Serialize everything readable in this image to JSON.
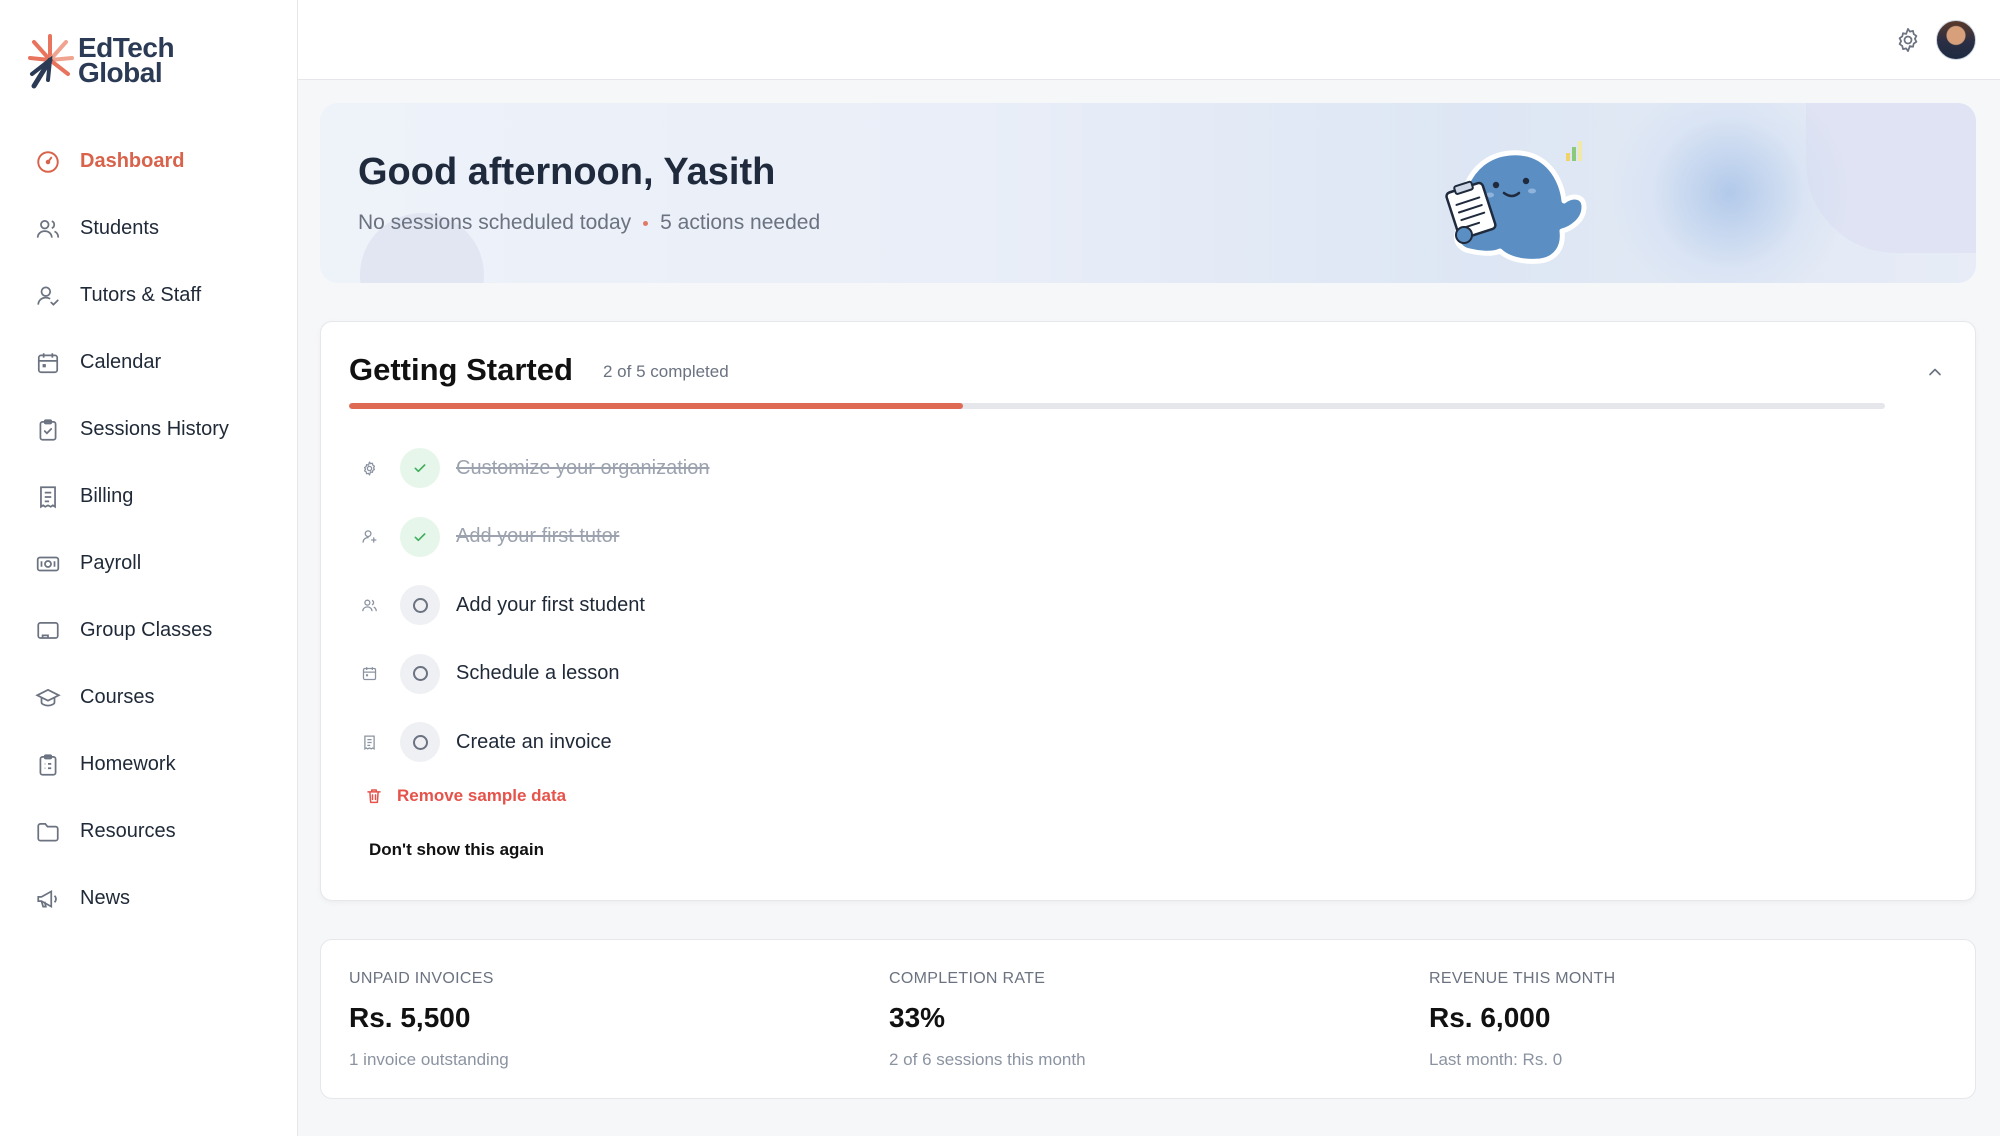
{
  "brand": {
    "name_line1": "EdTech",
    "name_line2": "Global"
  },
  "nav": [
    {
      "label": "Dashboard",
      "icon": "gauge-icon",
      "active": true
    },
    {
      "label": "Students",
      "icon": "users-icon"
    },
    {
      "label": "Tutors & Staff",
      "icon": "user-check-icon"
    },
    {
      "label": "Calendar",
      "icon": "calendar-icon"
    },
    {
      "label": "Sessions History",
      "icon": "clipboard-check-icon"
    },
    {
      "label": "Billing",
      "icon": "receipt-icon"
    },
    {
      "label": "Payroll",
      "icon": "banknote-icon"
    },
    {
      "label": "Group Classes",
      "icon": "screen-icon"
    },
    {
      "label": "Courses",
      "icon": "graduation-cap-icon"
    },
    {
      "label": "Homework",
      "icon": "clipboard-list-icon"
    },
    {
      "label": "Resources",
      "icon": "folder-icon"
    },
    {
      "label": "News",
      "icon": "megaphone-icon"
    }
  ],
  "header": {
    "settings_icon": "gear-icon",
    "avatar": "user-avatar"
  },
  "greeting": {
    "title": "Good afternoon, Yasith",
    "sessions_text": "No sessions scheduled today",
    "actions_text": "5 actions needed"
  },
  "getting_started": {
    "title": "Getting Started",
    "count_text": "2 of 5 completed",
    "progress": 0.4,
    "tasks": [
      {
        "label": "Customize your organization",
        "icon": "gear-icon",
        "done": true
      },
      {
        "label": "Add your first tutor",
        "icon": "user-plus-icon",
        "done": true
      },
      {
        "label": "Add your first student",
        "icon": "users-icon",
        "done": false
      },
      {
        "label": "Schedule a lesson",
        "icon": "calendar-icon",
        "done": false
      },
      {
        "label": "Create an invoice",
        "icon": "receipt-icon",
        "done": false
      }
    ],
    "remove_sample_label": "Remove sample data",
    "dont_show_label": "Don't show this again"
  },
  "stats": [
    {
      "label": "UNPAID INVOICES",
      "value": "Rs. 5,500",
      "note": "1 invoice outstanding"
    },
    {
      "label": "COMPLETION RATE",
      "value": "33%",
      "note": "2 of 6 sessions this month"
    },
    {
      "label": "REVENUE THIS MONTH",
      "value": "Rs. 6,000",
      "note": "Last month: Rs. 0"
    }
  ],
  "colors": {
    "accent": "#de6a54",
    "done": "#3fae5c",
    "danger": "#e5534b"
  }
}
